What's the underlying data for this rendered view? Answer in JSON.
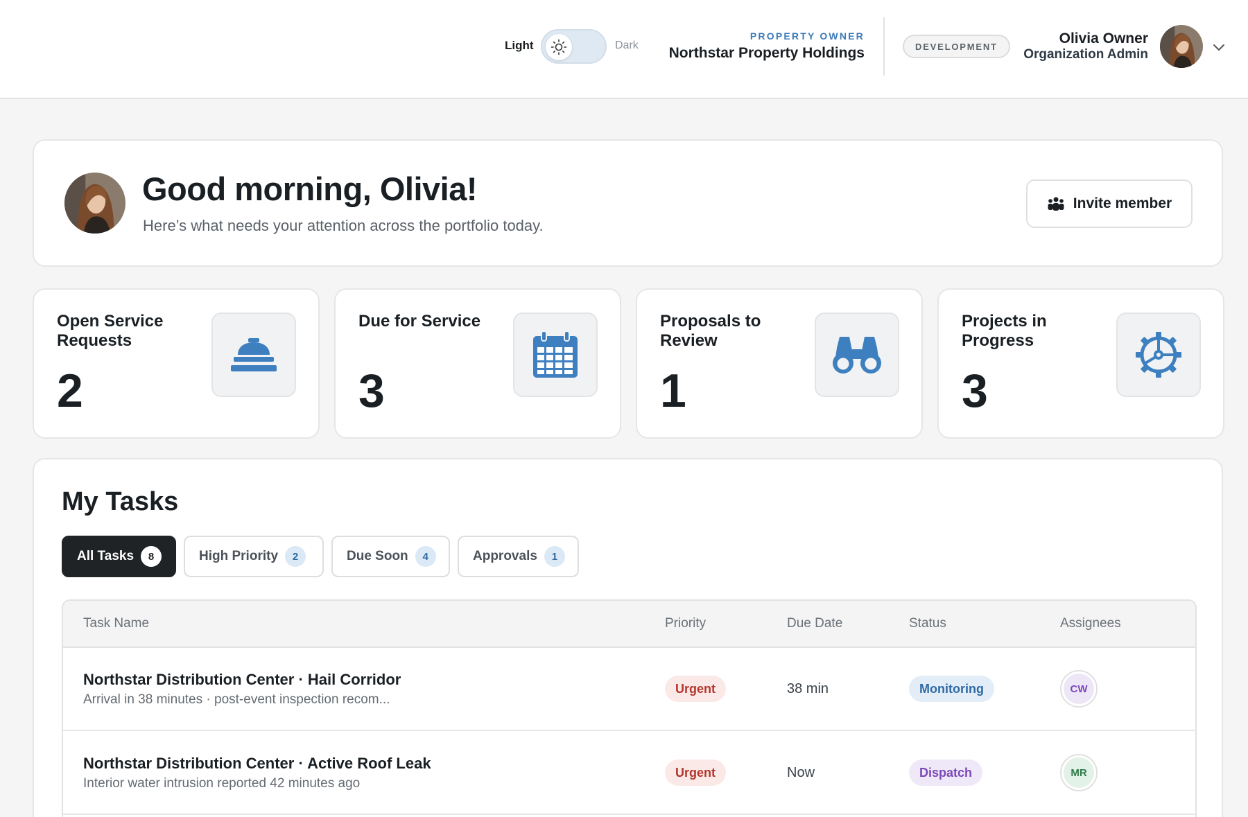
{
  "header": {
    "theme": {
      "light_label": "Light",
      "dark_label": "Dark",
      "mode": "light"
    },
    "org": {
      "role": "PROPERTY OWNER",
      "name": "Northstar Property Holdings"
    },
    "environment": "DEVELOPMENT",
    "user": {
      "name": "Olivia Owner",
      "role": "Organization Admin"
    }
  },
  "welcome": {
    "greeting": "Good morning, Olivia!",
    "subtitle": "Here’s what needs your attention across the portfolio today.",
    "invite_label": "Invite member"
  },
  "stats": [
    {
      "label": "Open Service Requests",
      "value": "2",
      "icon": "service-bell-icon"
    },
    {
      "label": "Due for Service",
      "value": "3",
      "icon": "calendar-icon"
    },
    {
      "label": "Proposals to Review",
      "value": "1",
      "icon": "binoculars-icon"
    },
    {
      "label": "Projects in Progress",
      "value": "3",
      "icon": "gear-icon"
    }
  ],
  "tasks": {
    "title": "My Tasks",
    "tabs": [
      {
        "label": "All Tasks",
        "count": "8",
        "active": true
      },
      {
        "label": "High Priority",
        "count": "2"
      },
      {
        "label": "Due Soon",
        "count": "4"
      },
      {
        "label": "Approvals",
        "count": "1"
      }
    ],
    "columns": [
      "Task Name",
      "Priority",
      "Due Date",
      "Status",
      "Assignees"
    ],
    "rows": [
      {
        "name": "Northstar Distribution Center · Hail Corridor",
        "description": "Arrival in 38 minutes · post-event inspection recom...",
        "priority": "Urgent",
        "due": "38 min",
        "status": "Monitoring",
        "assignee": "CW"
      },
      {
        "name": "Northstar Distribution Center · Active Roof Leak",
        "description": "Interior water intrusion reported 42 minutes ago",
        "priority": "Urgent",
        "due": "Now",
        "status": "Dispatch",
        "assignee": "MR"
      }
    ]
  },
  "colors": {
    "accent": "#3b7ab8",
    "icon_blue": "#3d7fbf",
    "urgent": "#b4362d",
    "monitoring": "#2f6aa3",
    "dispatch": "#7a48b8"
  }
}
